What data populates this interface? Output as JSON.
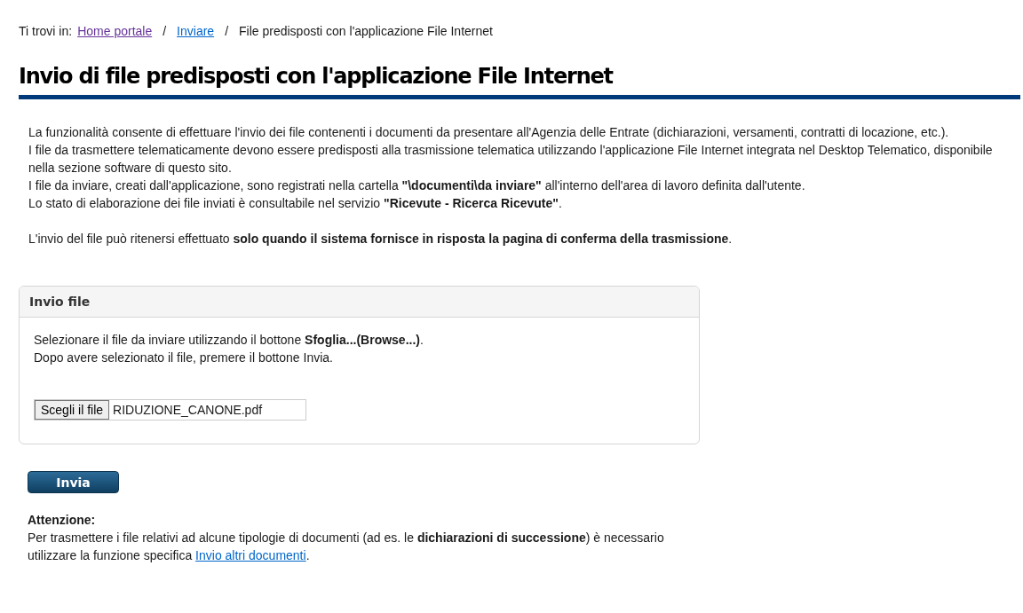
{
  "breadcrumb": {
    "label": "Ti trovi in:",
    "items": [
      {
        "text": "Home portale",
        "kind": "link",
        "visited": true
      },
      {
        "text": "Inviare",
        "kind": "link",
        "visited": false
      },
      {
        "text": "File predisposti con l'applicazione File Internet",
        "kind": "current"
      }
    ],
    "separator": "/"
  },
  "title": "Invio di file predisposti con l'applicazione File Internet",
  "intro": [
    "La funzionalità consente di effettuare l'invio dei file contenenti i documenti da presentare all'Agenzia delle Entrate (dichiarazioni, versamenti, contratti di locazione, etc.).",
    "I file da trasmettere telematicamente devono essere predisposti alla trasmissione telematica utilizzando l'applicazione File Internet integrata nel Desktop Telematico, disponibile nella sezione software di questo sito.",
    "I file da inviare, creati dall'applicazione, sono registrati nella cartella **\"\\documenti\\da inviare\"** all'interno dell'area di lavoro definita dall'utente.",
    "Lo stato di elaborazione dei file inviati è consultabile nel servizio **\"Ricevute - Ricerca Ricevute\"**."
  ],
  "notice": "L'invio del file può ritenersi effettuato **solo quando il sistema fornisce in risposta la pagina di conferma della trasmissione**.",
  "panel": {
    "title": "Invio file",
    "instructions": [
      "Selezionare il file da inviare utilizzando il bottone **Sfoglia...(Browse...)**.",
      "Dopo avere selezionato il file, premere il bottone Invia."
    ],
    "file_input": {
      "button": "Scegli il file",
      "value": "RIDUZIONE_CANONE.pdf"
    }
  },
  "submit": "Invia",
  "warning": {
    "title": "Attenzione:",
    "text": "Per trasmettere i file relativi ad alcune tipologie di documenti (ad es. le **dichiarazioni di successione**) è necessario utilizzare la funzione specifica ",
    "link": "Invio altri documenti",
    "after": "."
  }
}
